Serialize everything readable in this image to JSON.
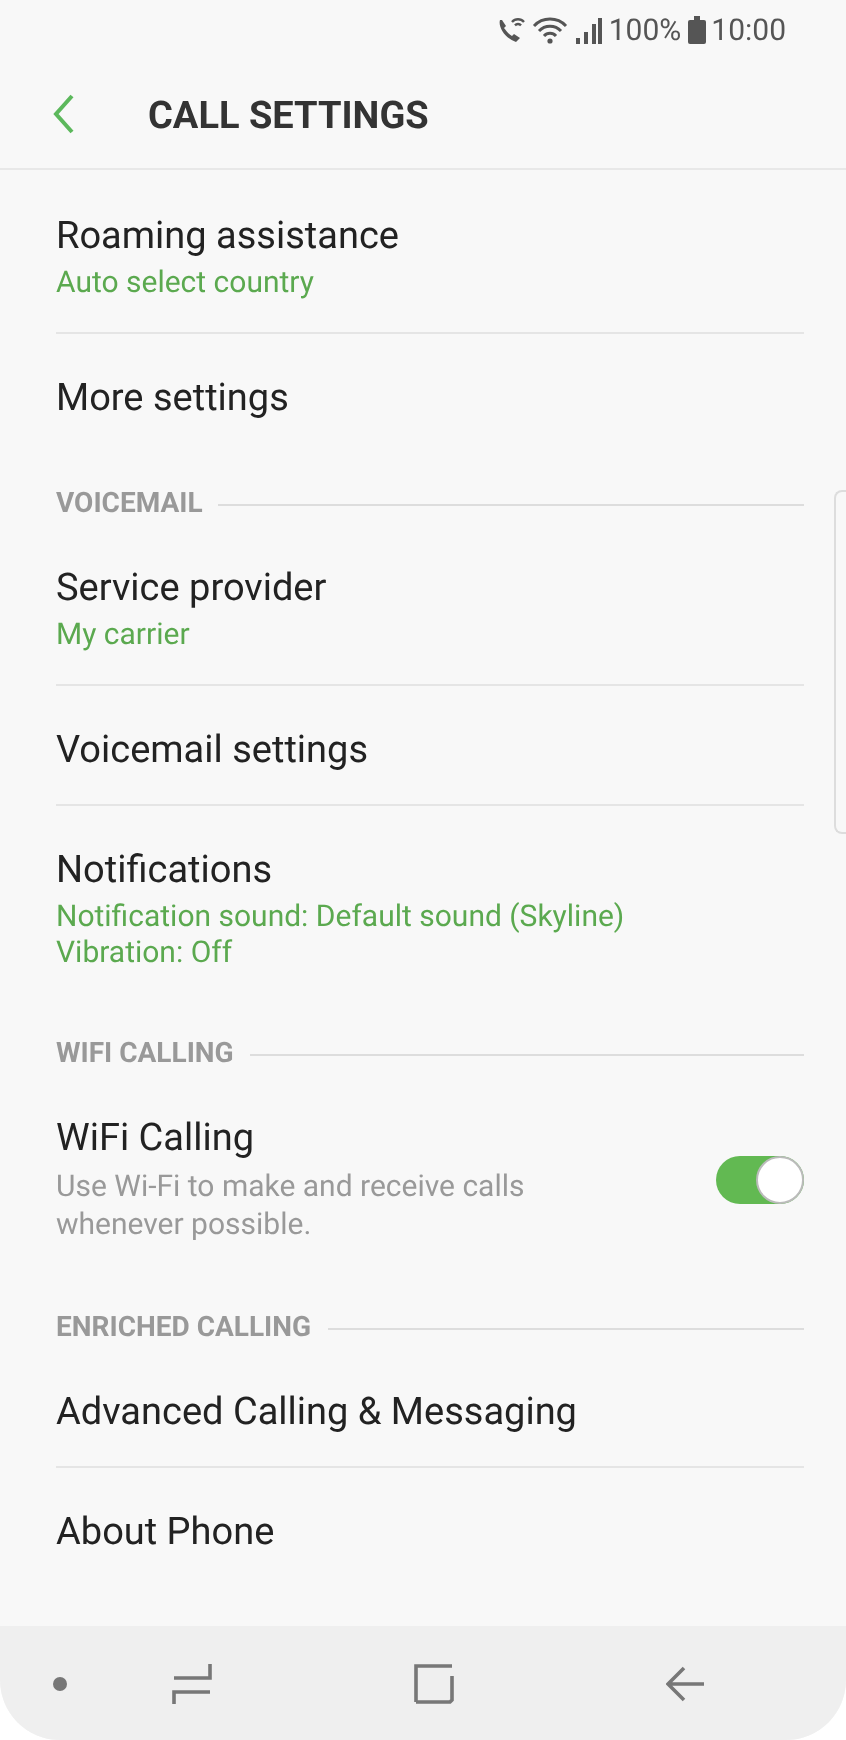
{
  "status_bar": {
    "battery": "100%",
    "time": "10:00"
  },
  "header": {
    "title": "CALL SETTINGS"
  },
  "sections": [
    {
      "items": [
        {
          "kind": "setting",
          "title": "Roaming assistance",
          "summary": [
            "Auto select country"
          ]
        },
        {
          "kind": "setting",
          "title": "More settings"
        }
      ]
    },
    {
      "title": "VOICEMAIL",
      "items": [
        {
          "kind": "setting",
          "title": "Service provider",
          "summary": [
            "My carrier"
          ]
        },
        {
          "kind": "setting",
          "title": "Voicemail settings"
        },
        {
          "kind": "setting",
          "title": "Notifications",
          "summary": [
            "Notification sound: Default sound (Skyline)",
            "Vibration: Off"
          ]
        }
      ]
    },
    {
      "title": "WIFI CALLING",
      "items": [
        {
          "kind": "toggle",
          "title": "WiFi Calling",
          "description": "Use Wi-Fi to make and receive calls whenever possible.",
          "on": true
        }
      ]
    },
    {
      "title": "ENRICHED CALLING",
      "items": [
        {
          "kind": "setting",
          "title": "Advanced Calling & Messaging"
        },
        {
          "kind": "setting",
          "title": "About Phone"
        }
      ]
    }
  ]
}
